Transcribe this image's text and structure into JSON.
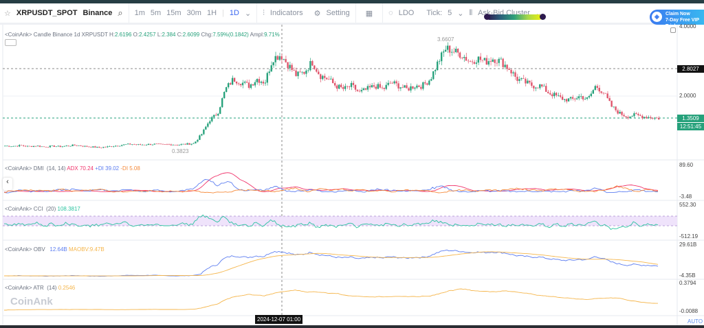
{
  "toolbar": {
    "symbol": "XRPUSDT_SPOT",
    "exchange": "Binance",
    "timeframes": [
      "1m",
      "5m",
      "15m",
      "30m",
      "1H",
      "1D"
    ],
    "active_timeframe": "1D",
    "indicators": "Indicators",
    "setting": "Setting",
    "ldo": "LDO",
    "tick_label": "Tick:",
    "tick_value": "5",
    "cluster": "Ask-Bid Cluster",
    "vip_line1": "Claim Now",
    "vip_line2": "7-Day Free VIP Trial"
  },
  "main": {
    "legend_prefix": "<CoinAnk> Candle  Binance 1d XRPUSDT",
    "h_label": "H:",
    "h": "2.6196",
    "o_label": "O:",
    "o": "2.4257",
    "l_label": "L:",
    "l": "2.384",
    "c_label": "C:",
    "c": "2.6099",
    "chg_label": "Chg:",
    "chg": "7.59%(0.1842)",
    "ampl_label": "Ampl:",
    "ampl": "9.71%",
    "high_marker": "3.6607",
    "low_marker": "0.3823",
    "axis_top": "4.0000",
    "axis_mid": "2.0000",
    "crosshair_price": "2.8027",
    "last_price": "1.3509",
    "countdown": "12:51:45",
    "up_color": "#26a17b",
    "down_color": "#e0546b"
  },
  "dmi": {
    "label": "<CoinAnk> DMI",
    "params": "(14, 14)",
    "adx": "ADX 70.24",
    "pdi": "+DI 39.02",
    "mdi": "-DI 5.08",
    "max": "89.60",
    "min": "-3.48"
  },
  "cci": {
    "label": "<CoinAnk> CCI",
    "params": "(20)",
    "value": "108.3817",
    "max": "552.30",
    "min": "-512.19"
  },
  "obv": {
    "label": "<CoinAnk> OBV",
    "value": "12.64B",
    "ma": "MAOBV:9.47B",
    "max": "29.61B",
    "min": "-4.35B"
  },
  "atr": {
    "label": "<CoinAnk> ATR",
    "params": "(14)",
    "value": "0.2546",
    "max": "0.3794",
    "min": "-0.0088"
  },
  "crosshair_date": "2024-12-07 01:00",
  "watermark": "CoinAnk",
  "auto": "AUTO",
  "chart_data": {
    "type": "candlestick",
    "price_range": [
      0,
      4
    ],
    "closes": [
      0.55,
      0.54,
      0.56,
      0.53,
      0.55,
      0.52,
      0.54,
      0.53,
      0.55,
      0.57,
      0.54,
      0.52,
      0.5,
      0.52,
      0.55,
      0.58,
      0.6,
      0.58,
      0.59,
      0.6,
      0.58,
      0.59,
      0.58,
      0.6,
      0.62,
      0.9,
      1.3,
      1.5,
      2.2,
      2.5,
      2.4,
      2.3,
      2.5,
      2.4,
      3.1,
      3.2,
      2.9,
      2.6,
      2.7,
      3.0,
      2.6,
      2.5,
      2.3,
      2.2,
      2.3,
      2.1,
      2.2,
      2.3,
      2.2,
      2.4,
      2.3,
      2.2,
      2.3,
      2.3,
      2.5,
      3.0,
      3.4,
      3.3,
      3.2,
      3.0,
      3.1,
      3.0,
      3.1,
      3.0,
      2.8,
      2.5,
      2.4,
      2.3,
      2.3,
      2.1,
      2.0,
      1.9,
      1.9,
      2.0,
      1.9,
      2.3,
      2.1,
      1.7,
      1.5,
      1.4,
      1.45,
      1.4,
      1.38,
      1.35
    ]
  }
}
